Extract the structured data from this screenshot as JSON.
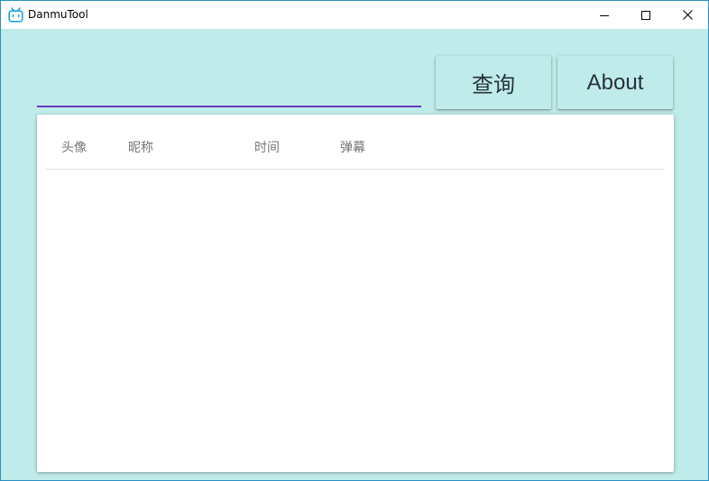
{
  "window": {
    "title": "DanmuTool",
    "icon": "bilibili-tv-icon",
    "controls": [
      "minimize-icon",
      "maximize-icon",
      "close-icon"
    ]
  },
  "search": {
    "value": "",
    "placeholder": ""
  },
  "toolbar": {
    "query_label": "查询",
    "about_label": "About"
  },
  "table": {
    "columns": [
      "头像",
      "昵称",
      "时间",
      "弹幕"
    ],
    "rows": []
  },
  "colors": {
    "background": "#c0ebeb",
    "input_underline": "#673ab7",
    "card": "#ffffff",
    "header_text": "#757575"
  }
}
